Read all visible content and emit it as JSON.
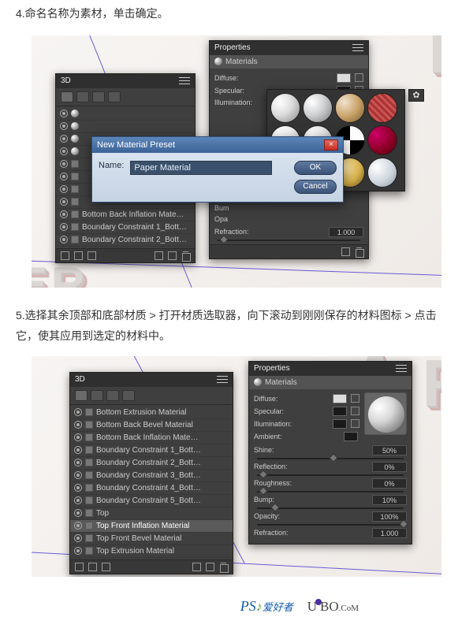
{
  "step4": "4.命名名称为素材，单击确定。",
  "step5": "5.选择其余顶部和底部材质 > 打开材质选取器，向下滚动到刚刚保存的材料图标 > 点击它，使其应用到选定的材料中。",
  "panel3d": {
    "tab": "3D",
    "rows_top": [
      "Bottom Back Inflation Mate…",
      "Boundary Constraint 1_Bott…",
      "Boundary Constraint 2_Bott…"
    ],
    "eye_rows": 11
  },
  "props1": {
    "panel_title": "Properties",
    "tab": "Materials",
    "labels": {
      "diffuse": "Diffuse:",
      "specular": "Specular:",
      "illumination": "Illumination:",
      "bump": "Bum",
      "opacity": "Opa",
      "refraction": "Refraction:"
    },
    "refraction_value": "1.000"
  },
  "modal": {
    "title": "New Material Preset",
    "name_label": "Name:",
    "name_value": "Paper Material",
    "ok": "OK",
    "cancel": "Cancel"
  },
  "panel3d_2": {
    "tab": "3D",
    "rows": [
      "Bottom Extrusion Material",
      "Bottom Back Bevel Material",
      "Bottom Back Inflation Mate…",
      "Boundary Constraint 1_Bott…",
      "Boundary Constraint 2_Bott…",
      "Boundary Constraint 3_Bott…",
      "Boundary Constraint 4_Bott…",
      "Boundary Constraint 5_Bott…",
      "Top",
      "Top Front Inflation Material",
      "Top Front Bevel Material",
      "Top Extrusion Material"
    ],
    "selected_index": 9
  },
  "props2": {
    "panel_title": "Properties",
    "tab": "Materials",
    "labels": {
      "diffuse": "Diffuse:",
      "specular": "Specular:",
      "illumination": "Illumination:",
      "ambient": "Ambient:",
      "shine": "Shine:",
      "reflection": "Reflection:",
      "roughness": "Roughness:",
      "bump": "Bump:",
      "opacity": "Opacity:",
      "refraction": "Refraction:"
    },
    "values": {
      "shine": "50%",
      "reflection": "0%",
      "roughness": "0%",
      "bump": "10%",
      "opacity": "100%",
      "refraction": "1.000"
    },
    "knob_pos": {
      "shine": 50,
      "reflection": 2,
      "roughness": 2,
      "bump": 10,
      "opacity": 98
    }
  },
  "logos": {
    "ps": "PS",
    "ps_cn": "爱好者",
    "uibo": "UiBO",
    "uibo_dom": ".CoM"
  }
}
